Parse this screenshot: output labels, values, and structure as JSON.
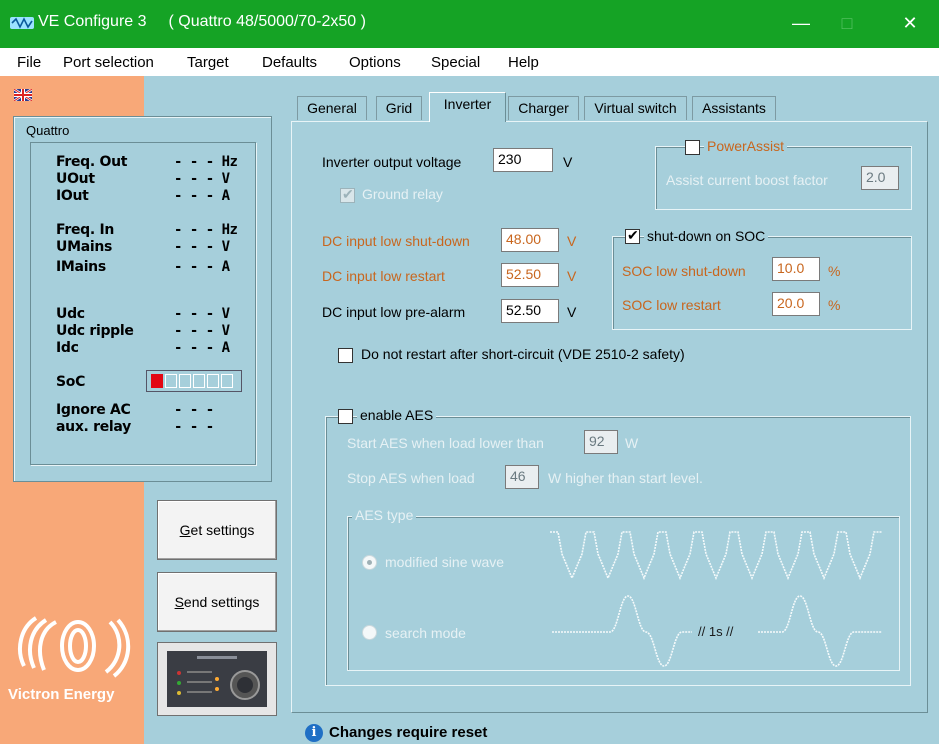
{
  "window": {
    "app_name": "VE Configure 3",
    "device": "( Quattro 48/5000/70-2x50 )",
    "minimize": "—",
    "maximize": "□",
    "close": "✕"
  },
  "menu": [
    "File",
    "Port selection",
    "Target",
    "Defaults",
    "Options",
    "Special",
    "Help"
  ],
  "status": {
    "title": "Quattro",
    "rows": [
      {
        "label": "Freq. Out",
        "value": "- - - Hz"
      },
      {
        "label": "UOut",
        "value": "- - - V"
      },
      {
        "label": "IOut",
        "value": "- - - A"
      },
      {
        "label": "Freq. In",
        "value": "- - - Hz"
      },
      {
        "label": "UMains",
        "value": "- - - V"
      },
      {
        "label": "IMains",
        "value": "- - - A"
      },
      {
        "label": "Udc",
        "value": "- - - V"
      },
      {
        "label": "Udc ripple",
        "value": "- - - V"
      },
      {
        "label": "Idc",
        "value": "- - - A"
      },
      {
        "label": "SoC",
        "value": ""
      },
      {
        "label": "Ignore AC",
        "value": "- - -"
      },
      {
        "label": "aux. relay",
        "value": "- - -"
      }
    ],
    "soc_level": 0.17,
    "soc_color": "#e30613"
  },
  "buttons": {
    "get_settings_u": "G",
    "get_settings_rest": "et settings",
    "send_settings_u": "S",
    "send_settings_rest": "end settings"
  },
  "logo": {
    "text": "Victron Energy"
  },
  "tabs": [
    "General",
    "Grid",
    "Inverter",
    "Charger",
    "Virtual switch",
    "Assistants"
  ],
  "active_tab": "Inverter",
  "inverter": {
    "output_voltage_label": "Inverter output voltage",
    "output_voltage": "230",
    "output_voltage_unit": "V",
    "ground_relay_label": "Ground relay",
    "dc_low_shutdown_label": "DC input low shut-down",
    "dc_low_shutdown": "48.00",
    "dc_low_restart_label": "DC input low restart",
    "dc_low_restart": "52.50",
    "dc_low_prealarm_label": "DC input low pre-alarm",
    "dc_low_prealarm": "52.50",
    "unit_v": "V",
    "powerassist_label": "PowerAssist",
    "assist_boost_label": "Assist current boost factor",
    "assist_boost_value": "2.0",
    "soc_group_label": "shut-down on SOC",
    "soc_low_shutdown_label": "SOC low shut-down",
    "soc_low_shutdown": "10.0",
    "soc_low_restart_label": "SOC low restart",
    "soc_low_restart": "20.0",
    "percent": "%",
    "no_restart_label": "Do not restart after short-circuit (VDE 2510-2  safety)",
    "aes_label": "enable AES",
    "aes_start_label": "Start AES when load lower than",
    "aes_start_value": "92",
    "aes_start_unit": "W",
    "aes_stop_label": "Stop AES when load",
    "aes_stop_value": "46",
    "aes_stop_unit": "W  higher than start level.",
    "aes_type_label": "AES type",
    "aes_modified_sine": "modified sine wave",
    "aes_search_mode": "search mode",
    "aes_interval": "// 1s //"
  },
  "info": {
    "text": "Changes require reset"
  }
}
